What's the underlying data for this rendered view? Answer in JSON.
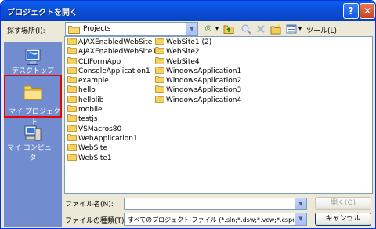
{
  "dialog": {
    "title": "プロジェクトを開く",
    "help_glyph": "?",
    "close_glyph": "✕"
  },
  "toolbar": {
    "look_in_label": "探す場所(I):",
    "look_in_value": "Projects",
    "dropdown_glyph": "▼",
    "back_glyph": "◎",
    "back_arrow": "▾",
    "views_label": "ツール(L)",
    "views_arrow": "▾"
  },
  "places": [
    {
      "label": "デスクトップ",
      "icon": "desktop-icon"
    },
    {
      "label": "マイ プロジェクト",
      "icon": "folder-icon",
      "selected": true
    },
    {
      "label": "マイ コンピュータ",
      "icon": "computer-icon"
    }
  ],
  "files": {
    "column1": [
      "AJAXEnabledWebSite",
      "AJAXEnabledWebSite1",
      "CLIFormApp",
      "ConsoleApplication1",
      "example",
      "hello",
      "hellolib",
      "mobile",
      "testjs",
      "VSMacros80",
      "WebApplication1",
      "WebSite",
      "WebSite1"
    ],
    "column2": [
      "WebSite1 (2)",
      "WebSite2",
      "WebSite4",
      "WindowsApplication1",
      "WindowsApplication2",
      "WindowsApplication3",
      "WindowsApplication4"
    ]
  },
  "footer": {
    "filename_label": "ファイル名(N):",
    "filename_value": "",
    "filetype_label": "ファイルの種類(T):",
    "filetype_value": "すべてのプロジェクト ファイル (*.sln;*.dsw;*.vcw;*.csproj;*.",
    "open_label": "開く(O)",
    "cancel_label": "キャンセル"
  },
  "colors": {
    "title_bar": "#0a5fef",
    "places_bar": "#728dcf",
    "selection_border": "#e00000"
  }
}
